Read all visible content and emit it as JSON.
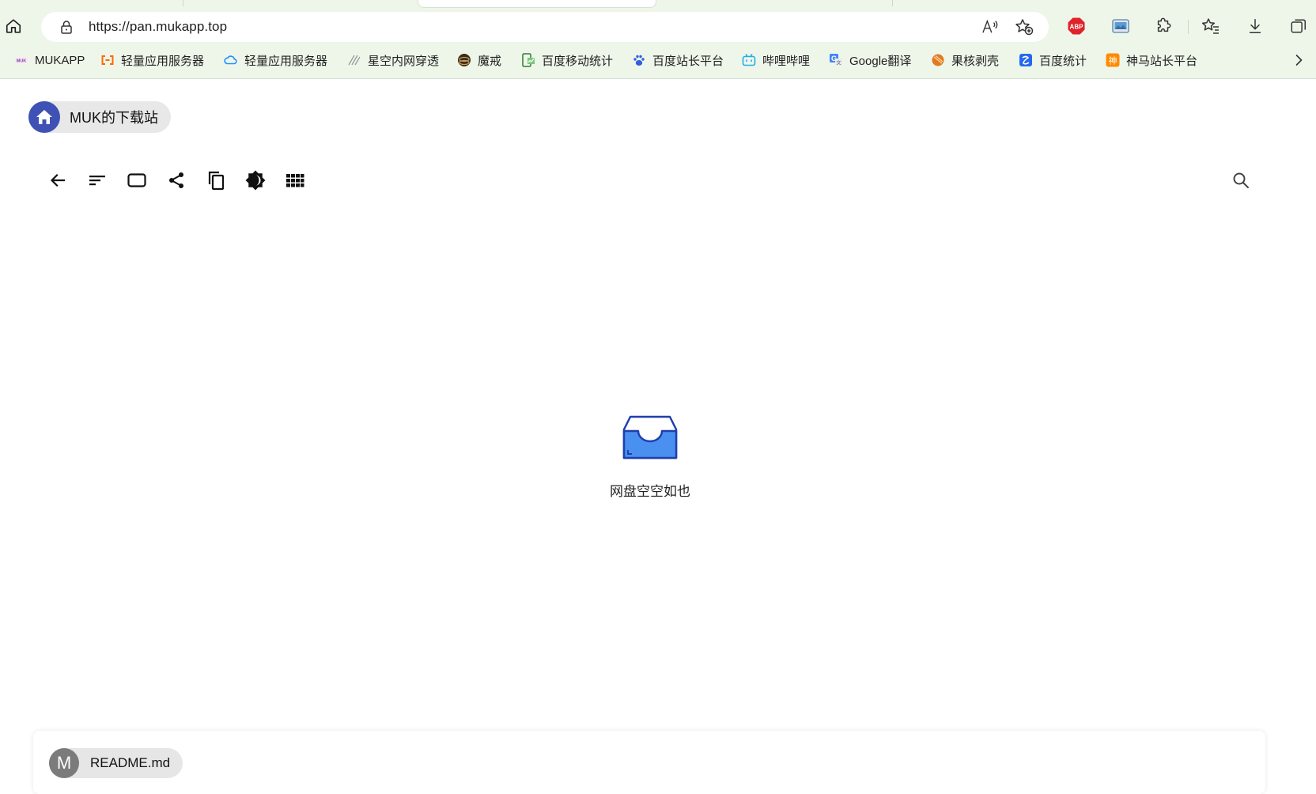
{
  "browser": {
    "url": "https://pan.mukapp.top",
    "icons": [
      "home-icon",
      "lock-icon",
      "read-aloud-icon",
      "add-favorite-icon",
      "adblock-plus-icon",
      "image-extension-icon",
      "extensions-icon",
      "favorites-icon",
      "downloads-icon",
      "collections-icon"
    ],
    "abp_label": "ABP"
  },
  "bookmarks": [
    {
      "label": "MUKAPP",
      "icon": "mukapp-favicon",
      "color": "#8a3fa0"
    },
    {
      "label": "轻量应用服务器",
      "icon": "aliyun-favicon",
      "color": "#ff6a00"
    },
    {
      "label": "轻量应用服务器",
      "icon": "cloud-favicon",
      "color": "#1e90ff"
    },
    {
      "label": "星空内网穿透",
      "icon": "star-favicon",
      "color": "#9a9a9a"
    },
    {
      "label": "魔戒",
      "icon": "ring-favicon",
      "color": "#3a2a1a"
    },
    {
      "label": "百度移动统计",
      "icon": "mobile-stats-favicon",
      "color": "#2e7d32"
    },
    {
      "label": "百度站长平台",
      "icon": "baidu-paw-favicon",
      "color": "#2f5fe0"
    },
    {
      "label": "哔哩哔哩",
      "icon": "bilibili-favicon",
      "color": "#23ade5"
    },
    {
      "label": "Google翻译",
      "icon": "google-translate-favicon",
      "color": "#4285f4"
    },
    {
      "label": "果核剥壳",
      "icon": "guohe-favicon",
      "color": "#e07a20"
    },
    {
      "label": "百度统计",
      "icon": "baidu-stats-favicon",
      "color": "#2468f2"
    },
    {
      "label": "神马站长平台",
      "icon": "shenma-favicon",
      "color": "#ff8a00"
    }
  ],
  "bookmark_glyphs": {
    "shenma": "神"
  },
  "site": {
    "title": "MUK的下载站",
    "accent": "#3f51b5"
  },
  "toolbar": [
    "back-icon",
    "sort-icon",
    "select-icon",
    "share-icon",
    "copy-icon",
    "theme-icon",
    "grid-view-icon",
    "search-icon"
  ],
  "empty_state": {
    "text": "网盘空空如也",
    "icon": "empty-tray-icon",
    "color": "#4a90f0"
  },
  "readme": {
    "avatar_letter": "M",
    "filename": "README.md"
  }
}
